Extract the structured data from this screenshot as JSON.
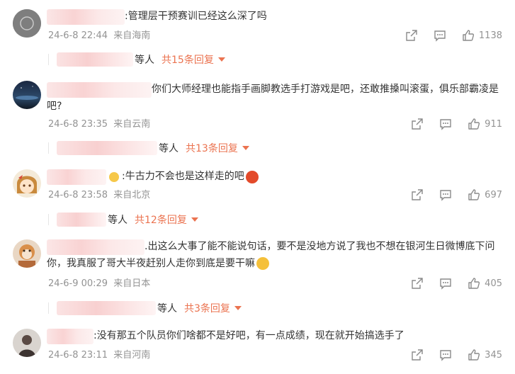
{
  "comments": [
    {
      "text": ":管理层干预赛训已经这么深了吗",
      "date": "24-6-8 22:44",
      "location": "来自海南",
      "likes": "1138",
      "reply_suffix": "等人",
      "reply_more": "共15条回复"
    },
    {
      "text": "你们大师经理也能指手画脚教选手打游戏是吧，还敢推搡叫滚蛋，俱乐部霸凌是吧?",
      "date": "24-6-8 23:35",
      "location": "来自云南",
      "likes": "911",
      "reply_suffix": "等人",
      "reply_more": "共13条回复"
    },
    {
      "text": ":牛古力不会也是这样走的吧",
      "date": "24-6-8 23:58",
      "location": "来自北京",
      "likes": "697",
      "reply_suffix": "等人",
      "reply_more": "共12条回复"
    },
    {
      "text": ".出这么大事了能不能说句话，要不是没地方说了我也不想在银河生日微博底下问你，我真服了哥大半夜赶别人走你到底是要干嘛",
      "date": "24-6-9 00:29",
      "location": "来自日本",
      "likes": "405",
      "reply_suffix": "等人",
      "reply_more": "共3条回复"
    },
    {
      "text": ":没有那五个队员你们啥都不是好吧，有一点成绩，现在就开始搞选手了",
      "date": "24-6-8 23:11",
      "location": "来自河南",
      "likes": "345"
    }
  ],
  "colors": {
    "accent": "#eb7350",
    "meta": "#939393",
    "text": "#333333"
  },
  "icons": [
    "share-icon",
    "comment-icon",
    "like-icon",
    "caret-down-icon"
  ]
}
